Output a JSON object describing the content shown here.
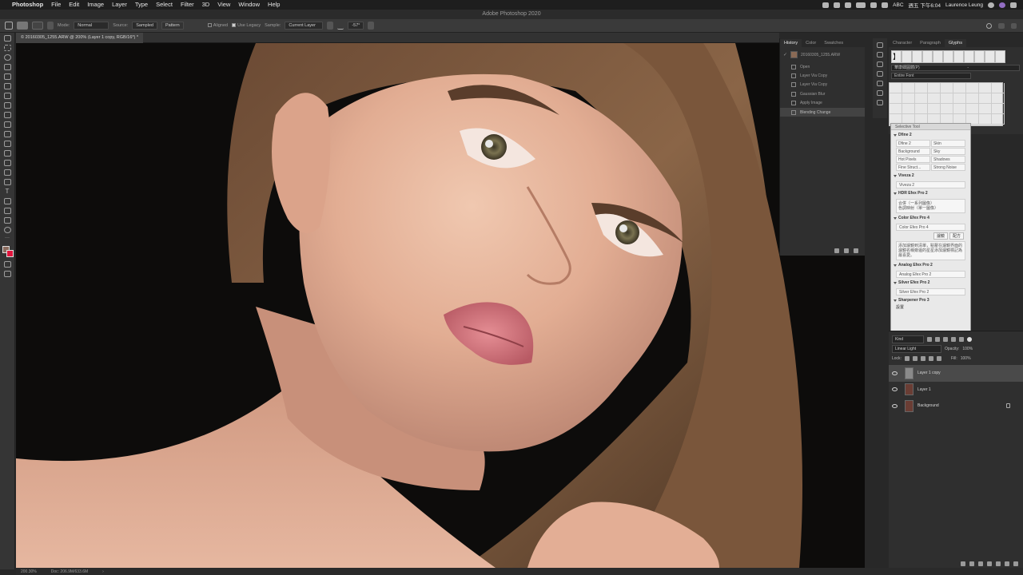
{
  "menubar": {
    "apple": "",
    "items": [
      "Photoshop",
      "File",
      "Edit",
      "Image",
      "Layer",
      "Type",
      "Select",
      "Filter",
      "3D",
      "View",
      "Window",
      "Help"
    ],
    "input_source": "ABC",
    "clock": "週五 下午6:04",
    "user": "Laurence Leung"
  },
  "window": {
    "title": "Adobe Photoshop 2020"
  },
  "options": {
    "mode_label": "Mode:",
    "mode_value": "Normal",
    "source_label": "Source:",
    "source_sampled": "Sampled",
    "source_pattern": "Pattern",
    "aligned_label": "Aligned",
    "legacy_label": "Use Legacy",
    "sample_label": "Sample:",
    "sample_value": "Current Layer",
    "angle_value": "-57°"
  },
  "document": {
    "tab_title": "© 20160305_1255.ARW @ 200% (Layer 1 copy, RGB/16*) *"
  },
  "status": {
    "zoom": "200.30%",
    "doc": "Doc: 206.9M/633.6M"
  },
  "history": {
    "tabs": [
      "History",
      "Color",
      "Swatches"
    ],
    "snapshot": "20160305_1255.ARW",
    "items": [
      "Open",
      "Layer Via Copy",
      "Layer Via Copy",
      "Gaussian Blur",
      "Apply Image",
      "Blending Change"
    ],
    "selected_index": 5
  },
  "glyphs": {
    "tabs": [
      "Character",
      "Paragraph",
      "Glyphs"
    ],
    "first_glyph": "】",
    "font": "華康細圓體(P)",
    "font_style": "-",
    "set": "Entire Font"
  },
  "selective": {
    "title": "Selective Tool",
    "dfine": {
      "name": "Dfine 2",
      "buttons": [
        [
          "Dfine 2",
          "Skin"
        ],
        [
          "Background",
          "Sky"
        ],
        [
          "Hot Pixels",
          "Shadows"
        ],
        [
          "Fine Struct...",
          "Strong Noise"
        ]
      ]
    },
    "viveza": {
      "name": "Viveza 2",
      "button": "Viveza 2"
    },
    "hdr": {
      "name": "HDR Efex Pro 2",
      "line1": "合併（一系列圖像）",
      "line2": "色調映射（單一圖像）"
    },
    "color": {
      "name": "Color Efex Pro 4",
      "button": "Color Efex Pro 4",
      "small1": "濾鏡",
      "small2": "配方",
      "note": "添加濾鏡到清單，點擊在濾鏡界面的濾鏡名稱旁邊的星星添加濾鏡標記為最喜愛。"
    },
    "analog": {
      "name": "Analog Efex Pro 2",
      "button": "Analog Efex Pro 2"
    },
    "silver": {
      "name": "Silver Efex Pro 2",
      "button": "Silver Efex Pro 2"
    },
    "sharpener": {
      "name": "Sharpener Pro 3",
      "button": "設置"
    }
  },
  "layers": {
    "filter": "Kind",
    "blend": "Linear Light",
    "opacity_label": "Opacity:",
    "opacity": "100%",
    "lock_label": "Lock:",
    "fill_label": "Fill:",
    "fill": "100%",
    "items": [
      {
        "name": "Layer 1 copy",
        "selected": true
      },
      {
        "name": "Layer 1",
        "selected": false
      },
      {
        "name": "Background",
        "selected": false,
        "locked": true
      }
    ]
  },
  "colors": {
    "foreground": "#8b6b5e",
    "background": "#e0143c",
    "accent": "#434343"
  }
}
